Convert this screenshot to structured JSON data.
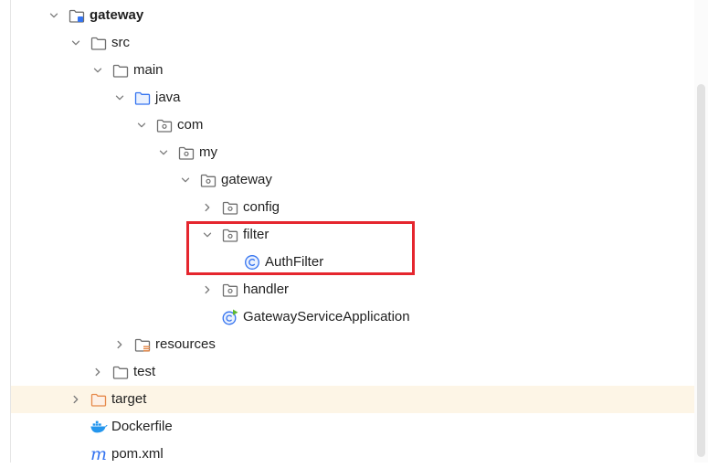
{
  "colors": {
    "folder": "#6e6e6e",
    "source_folder": "#3574f0",
    "excluded_folder": "#e6894a",
    "class_icon": "#3574f0",
    "highlight_bg": "#fdf5e6",
    "annotation_box": "#e5262e"
  },
  "tree": [
    {
      "label": "gateway",
      "depth": 0,
      "expanded": true,
      "icon": "module-folder-icon",
      "bold": true
    },
    {
      "label": "src",
      "depth": 1,
      "expanded": true,
      "icon": "folder-icon"
    },
    {
      "label": "main",
      "depth": 2,
      "expanded": true,
      "icon": "folder-icon"
    },
    {
      "label": "java",
      "depth": 3,
      "expanded": true,
      "icon": "source-folder-icon"
    },
    {
      "label": "com",
      "depth": 4,
      "expanded": true,
      "icon": "package-icon"
    },
    {
      "label": "my",
      "depth": 5,
      "expanded": true,
      "icon": "package-icon"
    },
    {
      "label": "gateway",
      "depth": 6,
      "expanded": true,
      "icon": "package-icon"
    },
    {
      "label": "config",
      "depth": 7,
      "expanded": false,
      "icon": "package-icon"
    },
    {
      "label": "filter",
      "depth": 7,
      "expanded": true,
      "icon": "package-icon"
    },
    {
      "label": "AuthFilter",
      "depth": 8,
      "icon": "class-icon"
    },
    {
      "label": "handler",
      "depth": 7,
      "expanded": false,
      "icon": "package-icon"
    },
    {
      "label": "GatewayServiceApplication",
      "depth": 7,
      "icon": "spring-boot-app-icon"
    },
    {
      "label": "resources",
      "depth": 3,
      "expanded": false,
      "icon": "resources-folder-icon"
    },
    {
      "label": "test",
      "depth": 2,
      "expanded": false,
      "icon": "folder-icon"
    },
    {
      "label": "target",
      "depth": 1,
      "expanded": false,
      "icon": "excluded-folder-icon",
      "highlighted": true
    },
    {
      "label": "Dockerfile",
      "depth": 1,
      "icon": "docker-icon"
    },
    {
      "label": "pom.xml",
      "depth": 1,
      "icon": "maven-icon"
    }
  ]
}
